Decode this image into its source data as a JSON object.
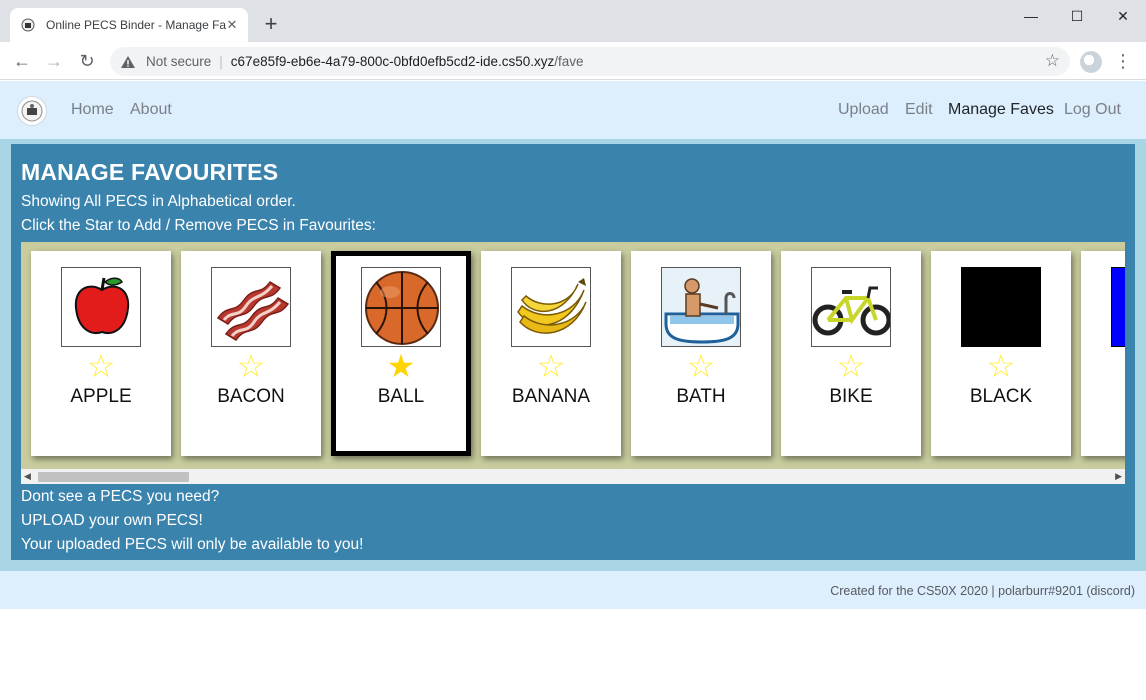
{
  "browser": {
    "tab_title": "Online PECS Binder - Manage Fav",
    "not_secure": "Not secure",
    "url_host": "c67e85f9-eb6e-4a79-800c-0bfd0efb5cd2-ide.cs50.xyz",
    "url_path": "/fave"
  },
  "navbar": {
    "left_links": [
      "Home",
      "About"
    ],
    "right_links": [
      "Upload",
      "Edit",
      "Manage Faves",
      "Log Out"
    ],
    "active": "Manage Faves"
  },
  "main": {
    "heading": "MANAGE FAVOURITES",
    "intro_1": "Showing All PECS in Alphabetical order.",
    "intro_2": "Click the Star to Add / Remove PECS in Favourites:",
    "outro_1": "Dont see a PECS you need?",
    "outro_2": "UPLOAD your own PECS!",
    "outro_3": "Your uploaded PECS will only be available to you!"
  },
  "cards": [
    {
      "label": "APPLE",
      "favourite": false,
      "icon": "apple-icon"
    },
    {
      "label": "BACON",
      "favourite": false,
      "icon": "bacon-icon"
    },
    {
      "label": "BALL",
      "favourite": true,
      "icon": "basketball-icon"
    },
    {
      "label": "BANANA",
      "favourite": false,
      "icon": "banana-icon"
    },
    {
      "label": "BATH",
      "favourite": false,
      "icon": "bath-icon"
    },
    {
      "label": "BIKE",
      "favourite": false,
      "icon": "bike-icon"
    },
    {
      "label": "BLACK",
      "favourite": false,
      "icon": "black-swatch-icon"
    },
    {
      "label": "",
      "favourite": false,
      "icon": "blue-swatch-icon"
    }
  ],
  "star_glyphs": {
    "on": "★",
    "off": "☆"
  },
  "footer": {
    "text": "Created for the CS50X 2020 | polarburr#9201 (discord)"
  },
  "colors": {
    "panel": "#3a83ad",
    "navbar": "#ddeefc",
    "gallery": "#c9cc9e",
    "star": "#ffd500"
  }
}
